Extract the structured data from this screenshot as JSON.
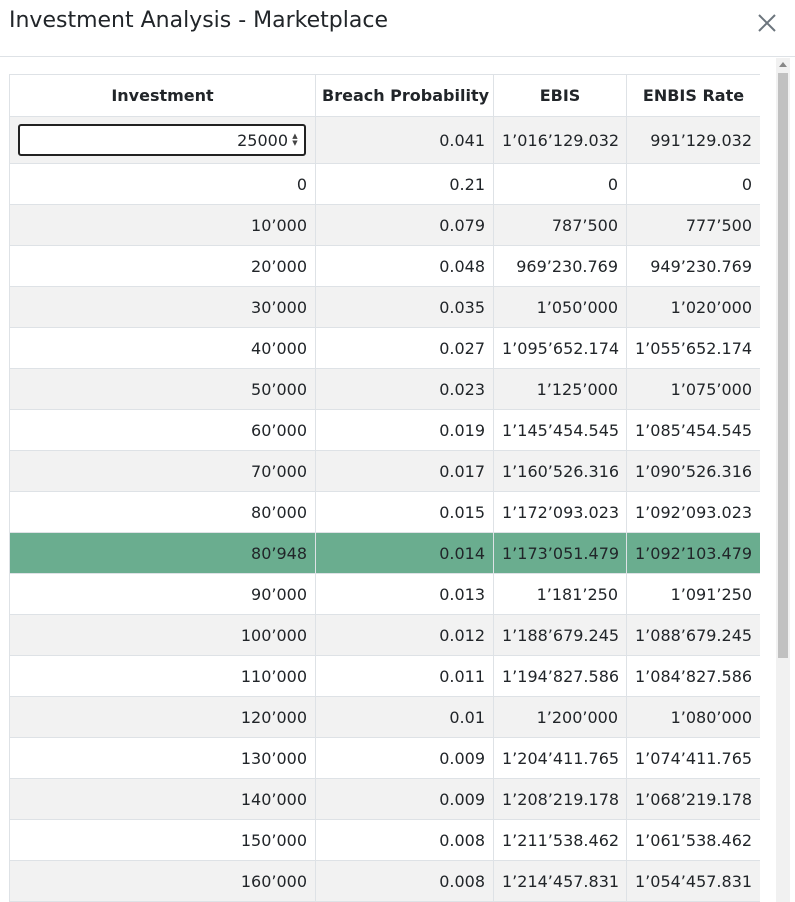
{
  "dialog": {
    "title": "Investment Analysis - Marketplace",
    "close_icon": "close-icon"
  },
  "table": {
    "headers": [
      "Investment",
      "Breach Probability",
      "EBIS",
      "ENBIS Rate"
    ],
    "input_row": {
      "investment_value": "25000",
      "breach_probability": "0.041",
      "ebis": "1’016’129.032",
      "enbis_rate": "991’129.032"
    },
    "rows": [
      {
        "investment": "0",
        "breach_probability": "0.21",
        "ebis": "0",
        "enbis_rate": "0"
      },
      {
        "investment": "10’000",
        "breach_probability": "0.079",
        "ebis": "787’500",
        "enbis_rate": "777’500"
      },
      {
        "investment": "20’000",
        "breach_probability": "0.048",
        "ebis": "969’230.769",
        "enbis_rate": "949’230.769"
      },
      {
        "investment": "30’000",
        "breach_probability": "0.035",
        "ebis": "1’050’000",
        "enbis_rate": "1’020’000"
      },
      {
        "investment": "40’000",
        "breach_probability": "0.027",
        "ebis": "1’095’652.174",
        "enbis_rate": "1’055’652.174"
      },
      {
        "investment": "50’000",
        "breach_probability": "0.023",
        "ebis": "1’125’000",
        "enbis_rate": "1’075’000"
      },
      {
        "investment": "60’000",
        "breach_probability": "0.019",
        "ebis": "1’145’454.545",
        "enbis_rate": "1’085’454.545"
      },
      {
        "investment": "70’000",
        "breach_probability": "0.017",
        "ebis": "1’160’526.316",
        "enbis_rate": "1’090’526.316"
      },
      {
        "investment": "80’000",
        "breach_probability": "0.015",
        "ebis": "1’172’093.023",
        "enbis_rate": "1’092’093.023"
      },
      {
        "investment": "80’948",
        "breach_probability": "0.014",
        "ebis": "1’173’051.479",
        "enbis_rate": "1’092’103.479",
        "highlight": true
      },
      {
        "investment": "90’000",
        "breach_probability": "0.013",
        "ebis": "1’181’250",
        "enbis_rate": "1’091’250"
      },
      {
        "investment": "100’000",
        "breach_probability": "0.012",
        "ebis": "1’188’679.245",
        "enbis_rate": "1’088’679.245"
      },
      {
        "investment": "110’000",
        "breach_probability": "0.011",
        "ebis": "1’194’827.586",
        "enbis_rate": "1’084’827.586"
      },
      {
        "investment": "120’000",
        "breach_probability": "0.01",
        "ebis": "1’200’000",
        "enbis_rate": "1’080’000"
      },
      {
        "investment": "130’000",
        "breach_probability": "0.009",
        "ebis": "1’204’411.765",
        "enbis_rate": "1’074’411.765"
      },
      {
        "investment": "140’000",
        "breach_probability": "0.009",
        "ebis": "1’208’219.178",
        "enbis_rate": "1’068’219.178"
      },
      {
        "investment": "150’000",
        "breach_probability": "0.008",
        "ebis": "1’211’538.462",
        "enbis_rate": "1’061’538.462"
      },
      {
        "investment": "160’000",
        "breach_probability": "0.008",
        "ebis": "1’214’457.831",
        "enbis_rate": "1’054’457.831"
      }
    ]
  },
  "colors": {
    "highlight_row": "#6aad8f",
    "striped_row": "#f2f2f2",
    "border": "#dee2e6"
  }
}
